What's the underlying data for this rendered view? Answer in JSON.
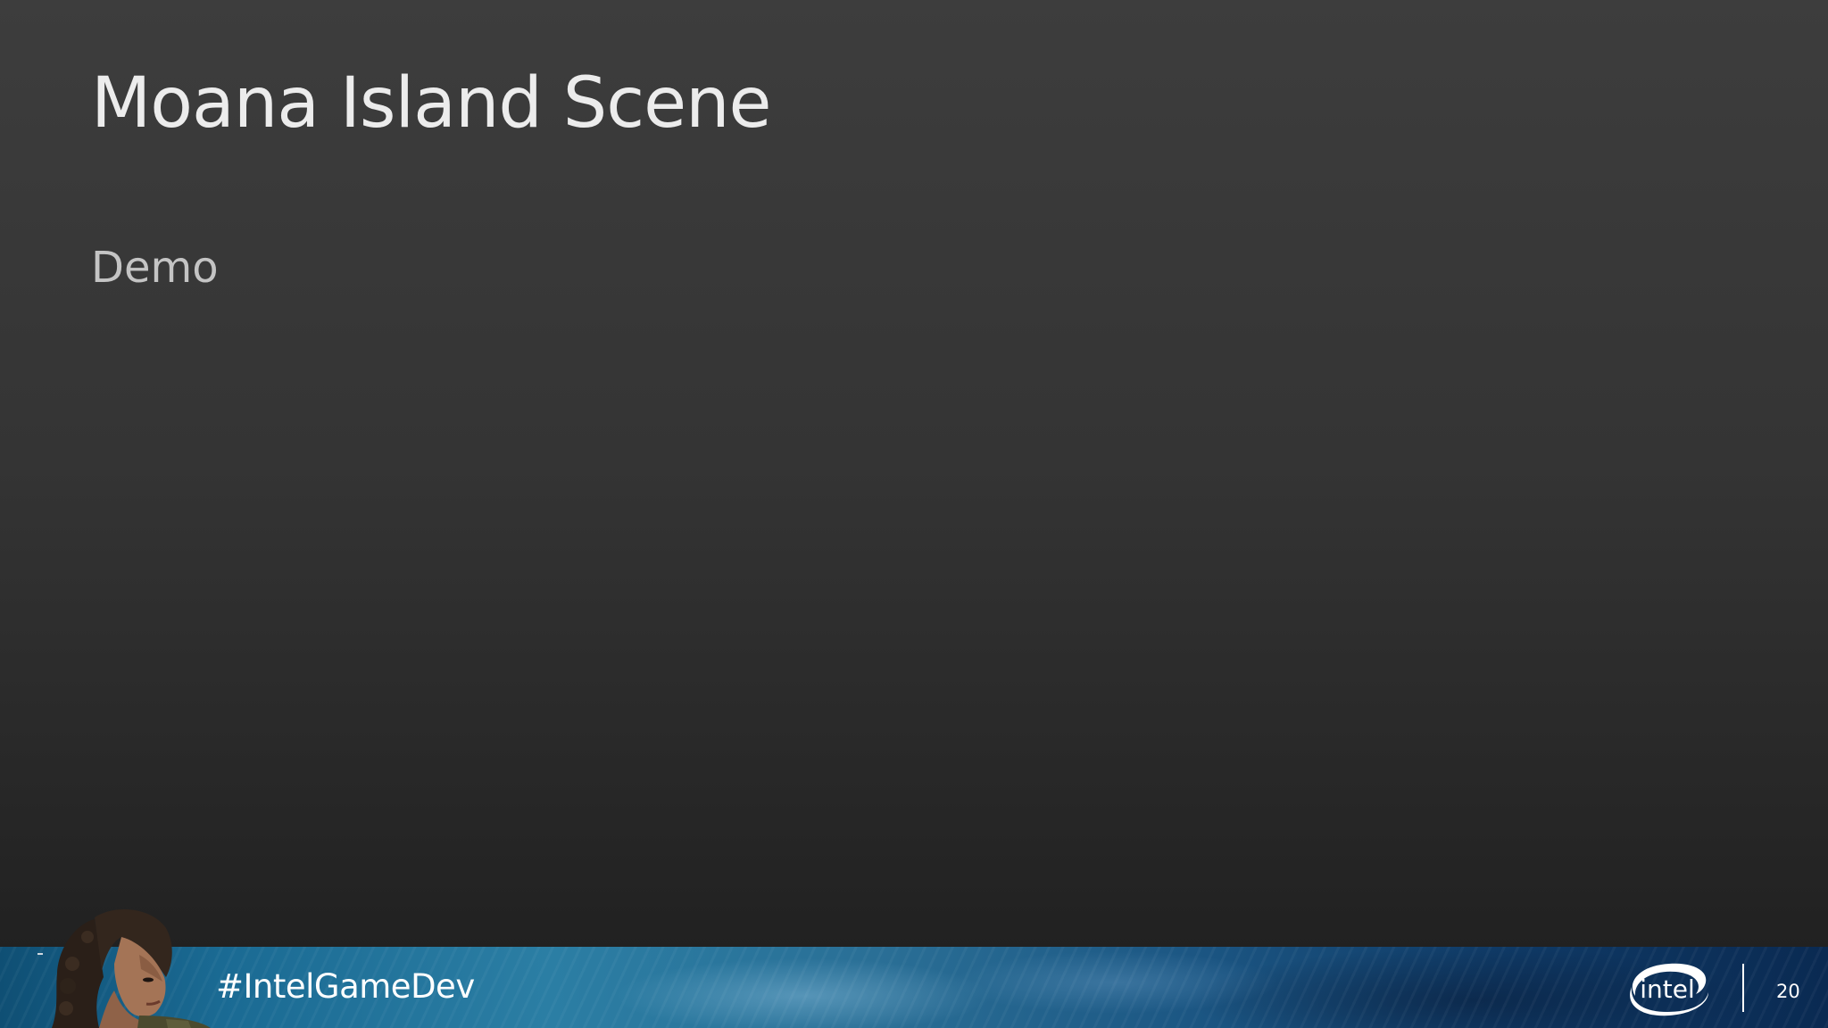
{
  "slide": {
    "title": "Moana Island Scene",
    "body": "Demo"
  },
  "footer": {
    "hashtag": "#IntelGameDev",
    "logo_text": "intel",
    "logo_icon": "intel-logo-icon",
    "character_icon": "game-character-portrait",
    "page_number": "20"
  },
  "colors": {
    "title": "#ececec",
    "body": "#c4c4c4",
    "background_top": "#3d3d3d",
    "background_bottom": "#1e1e1e",
    "footer_blue": "#1a6a93"
  }
}
